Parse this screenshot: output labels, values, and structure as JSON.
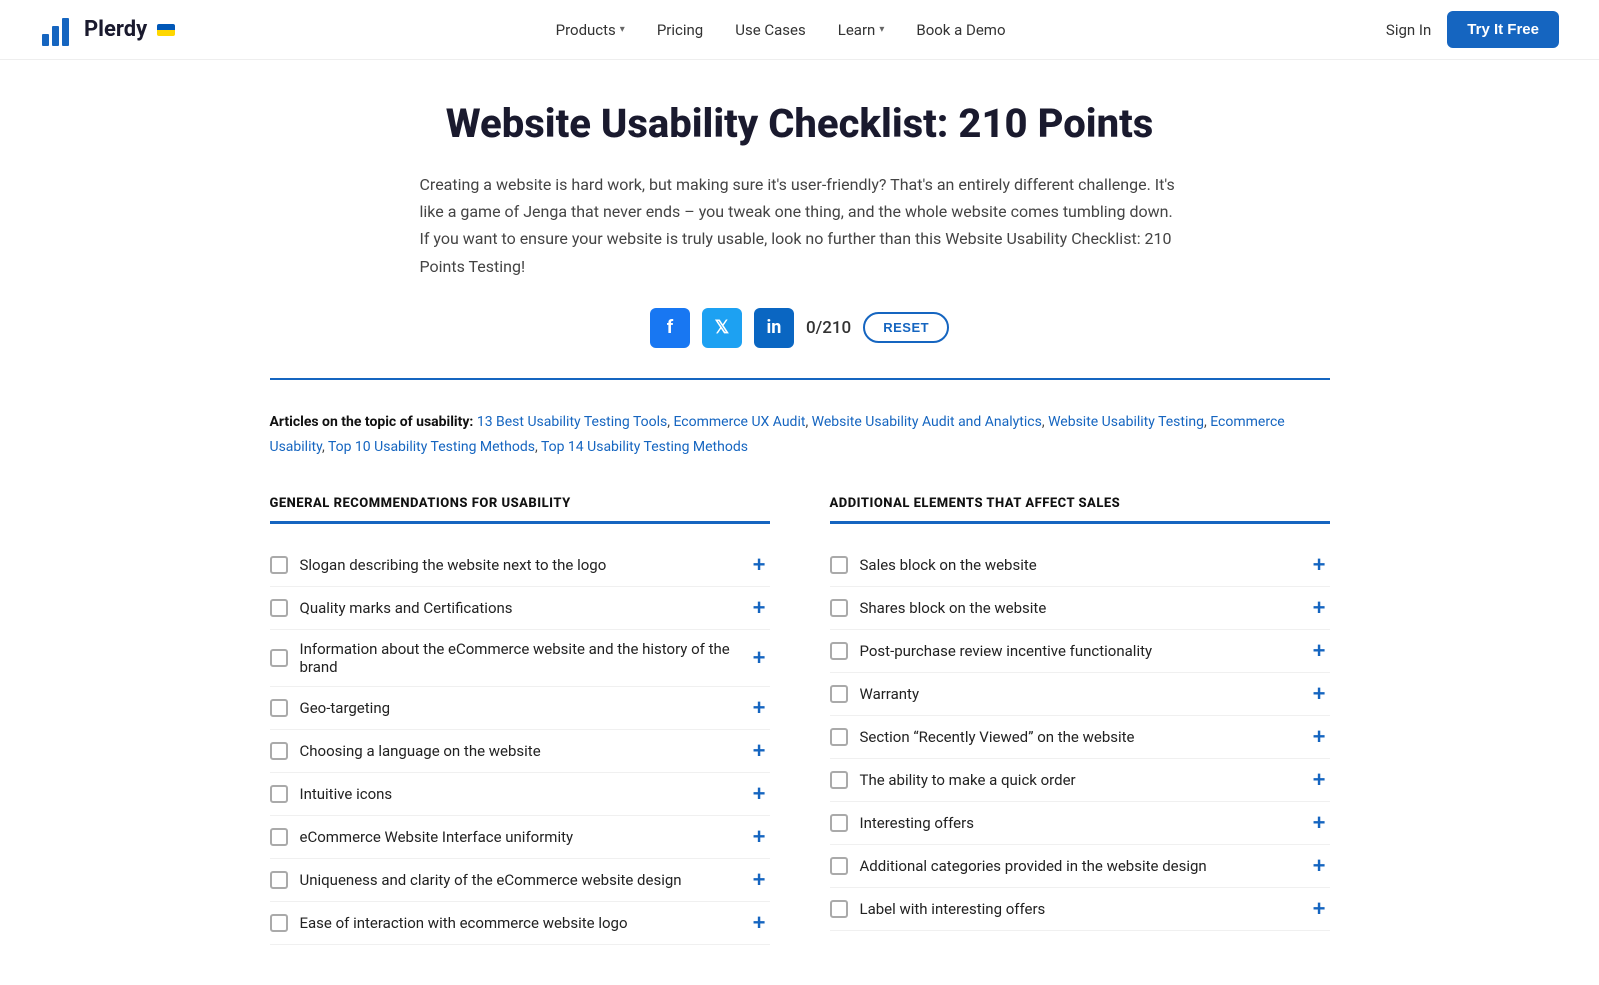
{
  "header": {
    "logo_text": "Plerdy",
    "nav": [
      {
        "label": "Products",
        "has_dropdown": true
      },
      {
        "label": "Pricing",
        "has_dropdown": false
      },
      {
        "label": "Use Cases",
        "has_dropdown": false
      },
      {
        "label": "Learn",
        "has_dropdown": true
      },
      {
        "label": "Book a Demo",
        "has_dropdown": false
      }
    ],
    "sign_in": "Sign In",
    "try_free": "Try It Free"
  },
  "hero": {
    "title": "Website Usability Checklist: 210 Points",
    "description": "Creating a website is hard work, but making sure it's user-friendly? That's an entirely different challenge. It's like a game of Jenga that never ends – you tweak one thing, and the whole website comes tumbling down. If you want to ensure your website is truly usable, look no further than this Website Usability Checklist: 210 Points Testing!",
    "counter": "0/210",
    "reset_label": "RESET"
  },
  "articles": {
    "prefix": "Articles on the topic of usability:",
    "links": [
      "13 Best Usability Testing Tools",
      "Ecommerce UX Audit",
      "Website Usability Audit and Analytics",
      "Website Usability Testing",
      "Ecommerce Usability",
      "Top 10 Usability Testing Methods",
      "Top 14 Usability Testing Methods"
    ]
  },
  "left_col": {
    "title": "GENERAL RECOMMENDATIONS FOR USABILITY",
    "items": [
      "Slogan describing the website next to the logo",
      "Quality marks and Certifications",
      "Information about the eCommerce website and the history of the brand",
      "Geo-targeting",
      "Choosing a language on the website",
      "Intuitive icons",
      "eCommerce Website Interface uniformity",
      "Uniqueness and clarity of the eCommerce website design",
      "Ease of interaction with ecommerce website logo"
    ]
  },
  "right_col": {
    "title": "ADDITIONAL ELEMENTS THAT AFFECT SALES",
    "items": [
      "Sales block on the website",
      "Shares block on the website",
      "Post-purchase review incentive functionality",
      "Warranty",
      "Section “Recently Viewed” on the website",
      "The ability to make a quick order",
      "Interesting offers",
      "Additional categories provided in the website design",
      "Label with interesting offers"
    ]
  },
  "social": {
    "facebook": "f",
    "twitter": "t",
    "linkedin": "in"
  }
}
